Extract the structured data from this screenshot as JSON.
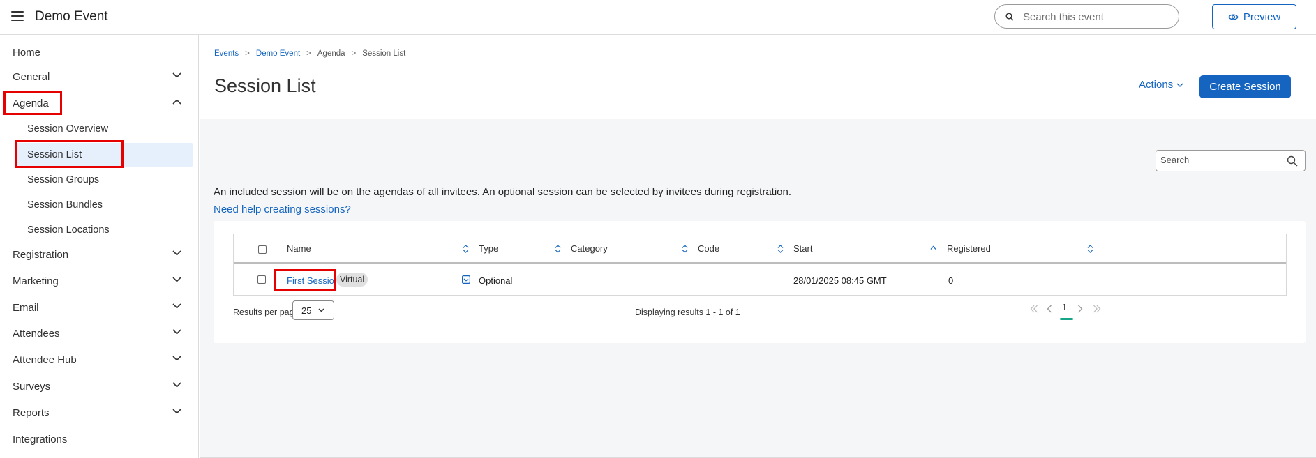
{
  "header": {
    "title": "Demo Event",
    "search_placeholder": "Search this event",
    "preview_label": "Preview"
  },
  "sidebar": {
    "items": [
      {
        "label": "Home"
      },
      {
        "label": "General"
      },
      {
        "label": "Agenda"
      },
      {
        "label": "Registration"
      },
      {
        "label": "Marketing"
      },
      {
        "label": "Email"
      },
      {
        "label": "Attendees"
      },
      {
        "label": "Attendee Hub"
      },
      {
        "label": "Surveys"
      },
      {
        "label": "Reports"
      },
      {
        "label": "Integrations"
      }
    ],
    "agenda_sub": [
      {
        "label": "Session Overview"
      },
      {
        "label": "Session List"
      },
      {
        "label": "Session Groups"
      },
      {
        "label": "Session Bundles"
      },
      {
        "label": "Session Locations"
      }
    ]
  },
  "breadcrumb": [
    "Events",
    "Demo Event",
    "Agenda",
    "Session List"
  ],
  "page": {
    "title": "Session List",
    "actions_label": "Actions",
    "create_label": "Create Session",
    "search_placeholder": "Search",
    "info_text": "An included session will be on the agendas of all invitees. An optional session can be selected by invitees during registration.",
    "help_link": "Need help creating sessions?"
  },
  "table": {
    "columns": [
      "Name",
      "Type",
      "Category",
      "Code",
      "Start",
      "Registered"
    ],
    "rows": [
      {
        "name": "First Session",
        "badge": "Virtual",
        "type": "Optional",
        "category": "",
        "code": "",
        "start": "28/01/2025 08:45 GMT",
        "registered": "0"
      }
    ]
  },
  "footer": {
    "results_per_page_label": "Results per page",
    "per_page_value": "25",
    "displaying": "Displaying results 1 - 1 of 1",
    "current_page": "1"
  },
  "colors": {
    "accent": "#1565c0",
    "highlight": "#e60000",
    "active_bg": "#e6f0fc",
    "pager_underline": "#17a589"
  }
}
